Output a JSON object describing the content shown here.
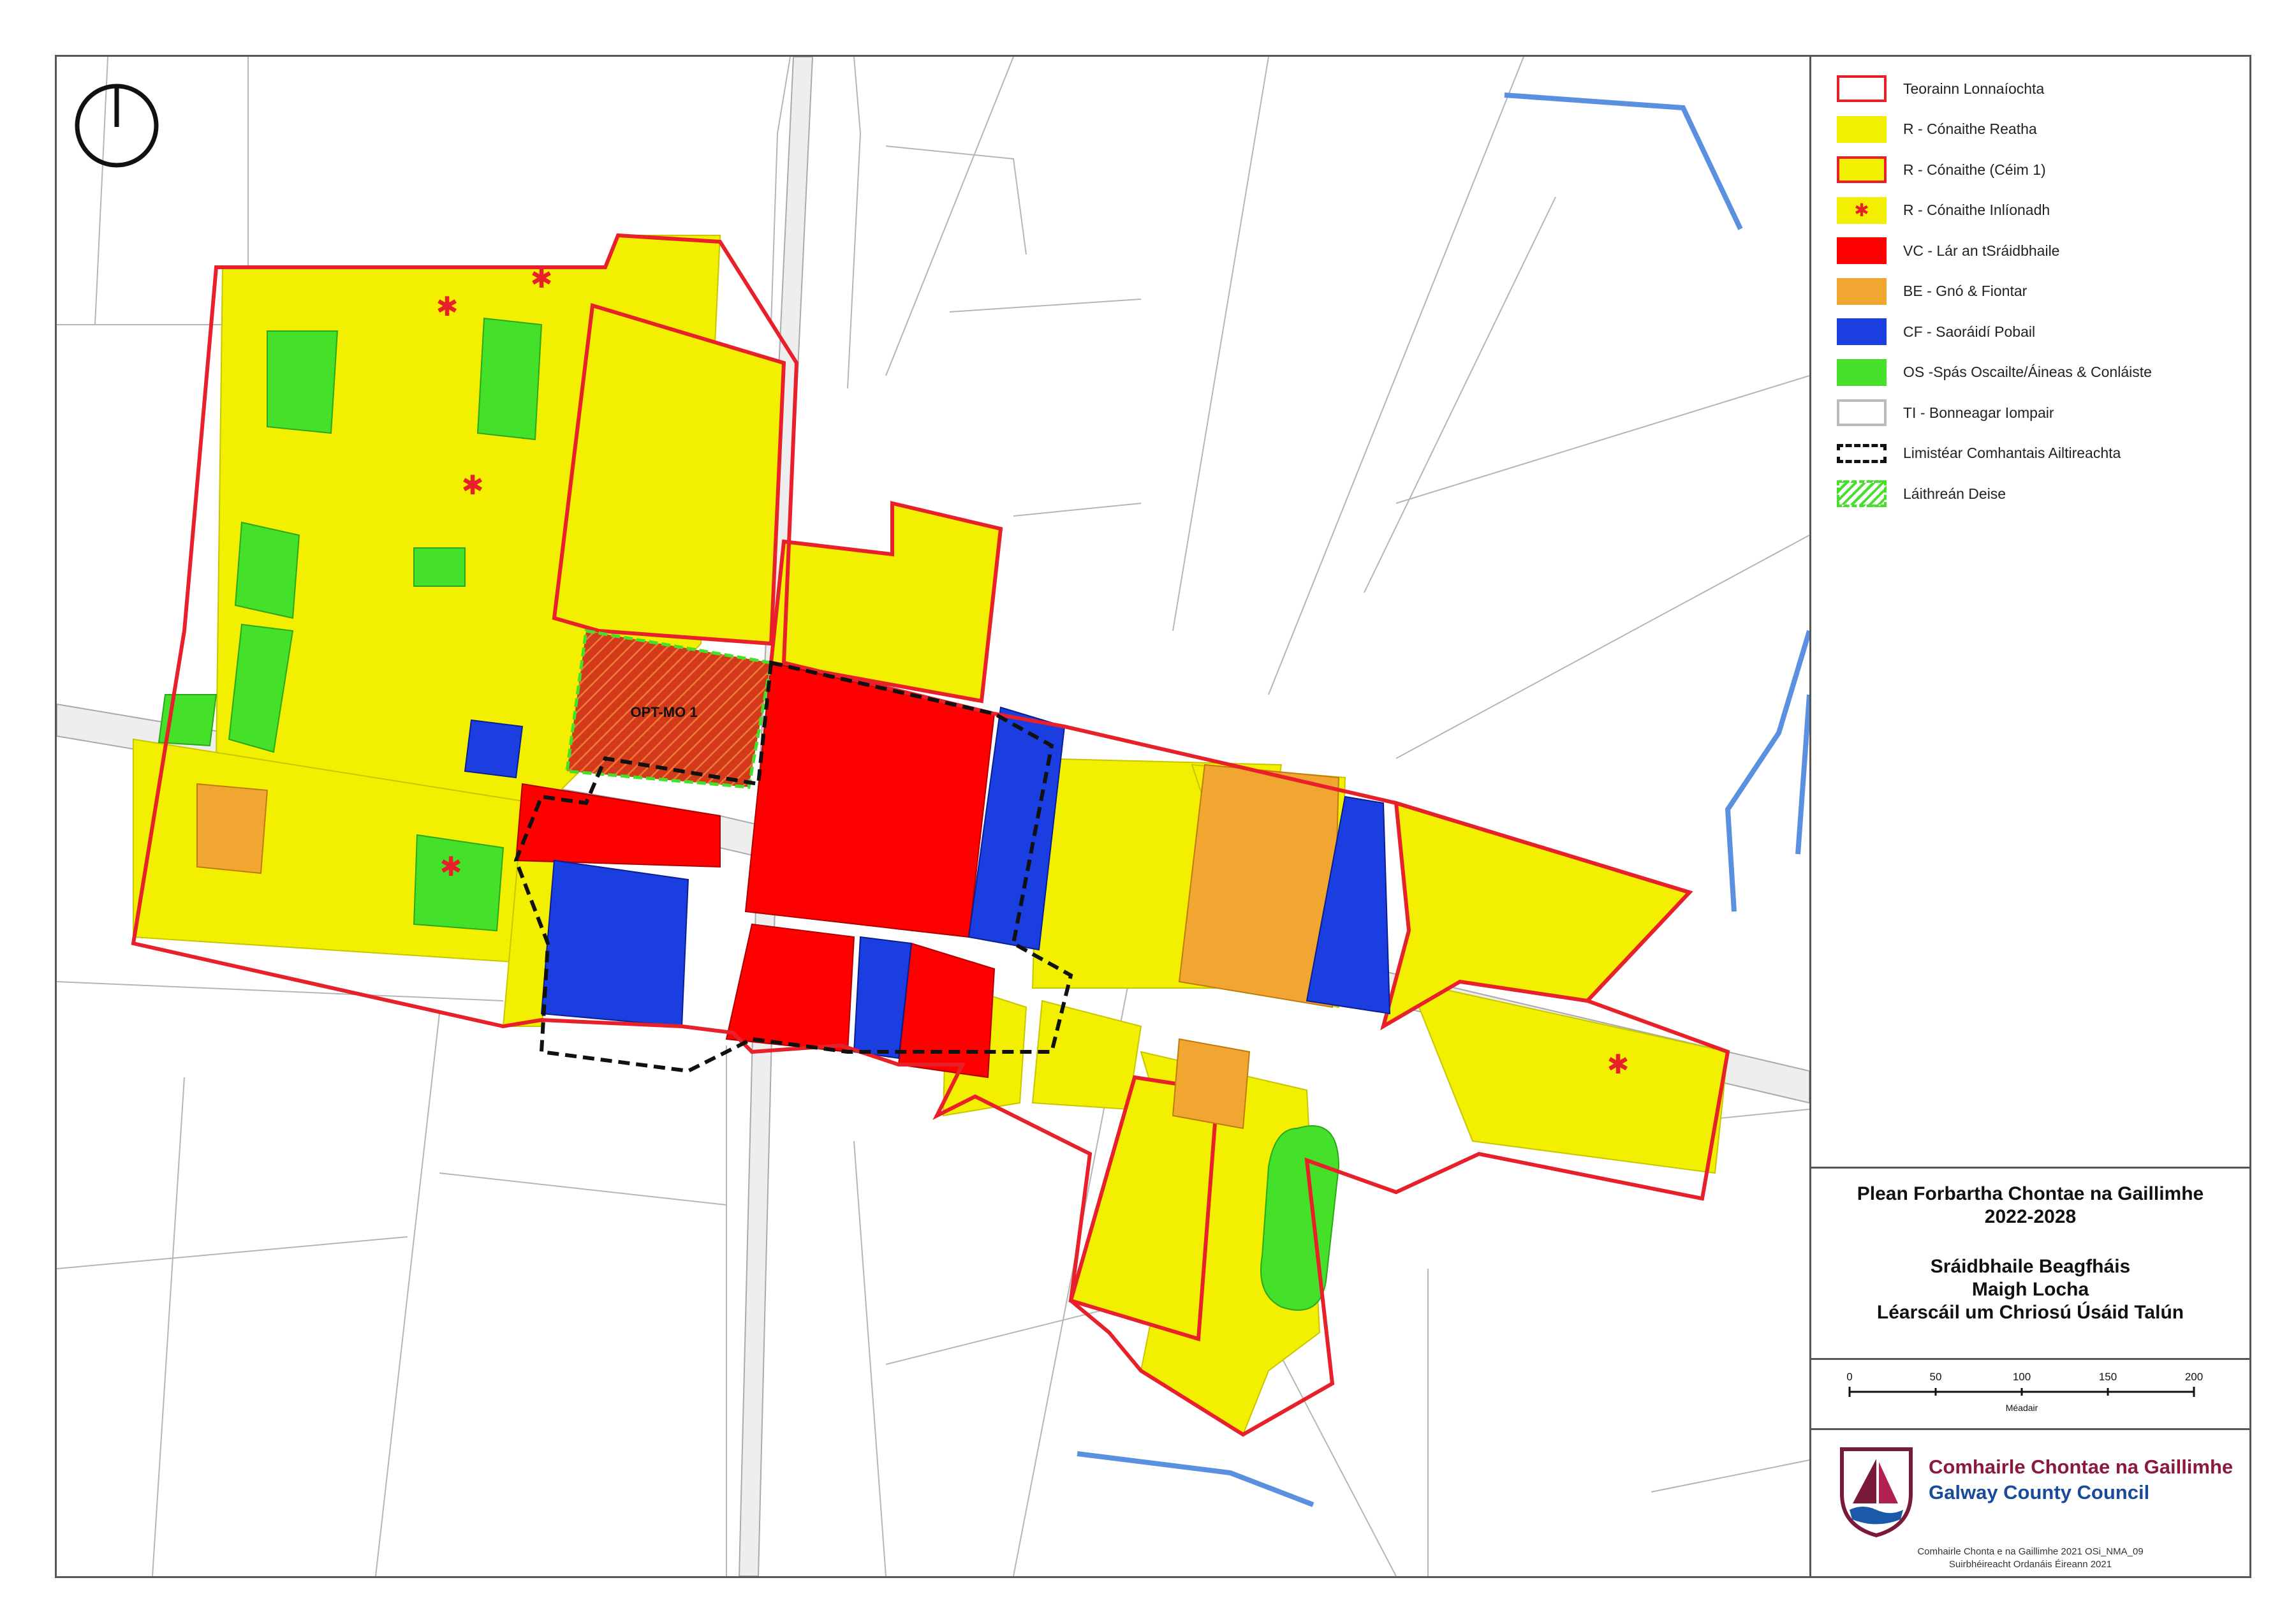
{
  "legend": {
    "items": [
      {
        "label": "Teorainn Lonnaíochta",
        "fill": "#ffffff",
        "border": "#e8202a",
        "pattern": "none"
      },
      {
        "label": "R - Cónaithe Reatha",
        "fill": "#f2f000",
        "border": "#f2f000",
        "pattern": "none"
      },
      {
        "label": "R - Cónaithe (Céim 1)",
        "fill": "#f2f000",
        "border": "#e8202a",
        "pattern": "none"
      },
      {
        "label": "R - Cónaithe Inlíonadh",
        "fill": "#f2f000",
        "border": "#f2f000",
        "pattern": "star"
      },
      {
        "label": "VC - Lár an tSráidbhaile",
        "fill": "#ff0000",
        "border": "#ff0000",
        "pattern": "none"
      },
      {
        "label": "BE - Gnó & Fiontar",
        "fill": "#f0a630",
        "border": "#f0a630",
        "pattern": "none"
      },
      {
        "label": "CF - Saoráidí Pobail",
        "fill": "#1a3ee0",
        "border": "#1a3ee0",
        "pattern": "none"
      },
      {
        "label": "OS -Spás Oscailte/Áineas & Conláiste",
        "fill": "#44e02a",
        "border": "#44e02a",
        "pattern": "none"
      },
      {
        "label": "TI - Bonneagar Iompair",
        "fill": "#ffffff",
        "border": "#bbbbbb",
        "pattern": "none"
      },
      {
        "label": "Limistéar Comhantais Ailtireachta",
        "fill": "#ffffff",
        "border": "#111111",
        "pattern": "dashed"
      },
      {
        "label": "Láithreán Deise",
        "fill": "#ffffff",
        "border": "#44e02a",
        "pattern": "hatch"
      }
    ]
  },
  "title": {
    "line1": "Plean Forbartha Chontae na Gaillimhe",
    "line2": "2022-2028",
    "line3": "Sráidbhaile Beagfháis",
    "line4": "Maigh Locha",
    "line5": "Léarscáil um Chriosú Úsáid Talún"
  },
  "scale": {
    "ticks": [
      "0",
      "50",
      "100",
      "150",
      "200"
    ],
    "unit": "Méadair"
  },
  "council": {
    "name_ga": "Comhairle Chontae na Gaillimhe",
    "name_en": "Galway County Council",
    "credit1": "Comhairle Chonta e na Gaillimhe 2021 OSi_NMA_09",
    "credit2": "Suirbhéireacht Ordanáis Éireann 2021"
  },
  "map": {
    "site_label": "OPT-MO 1",
    "colors": {
      "residential": "#f2f000",
      "village_centre": "#ff0000",
      "business": "#f0a630",
      "community": "#1a3ee0",
      "open_space": "#44e02a",
      "boundary": "#e8202a",
      "water": "#5b8fe0",
      "field_line": "#b5b5b5"
    }
  }
}
